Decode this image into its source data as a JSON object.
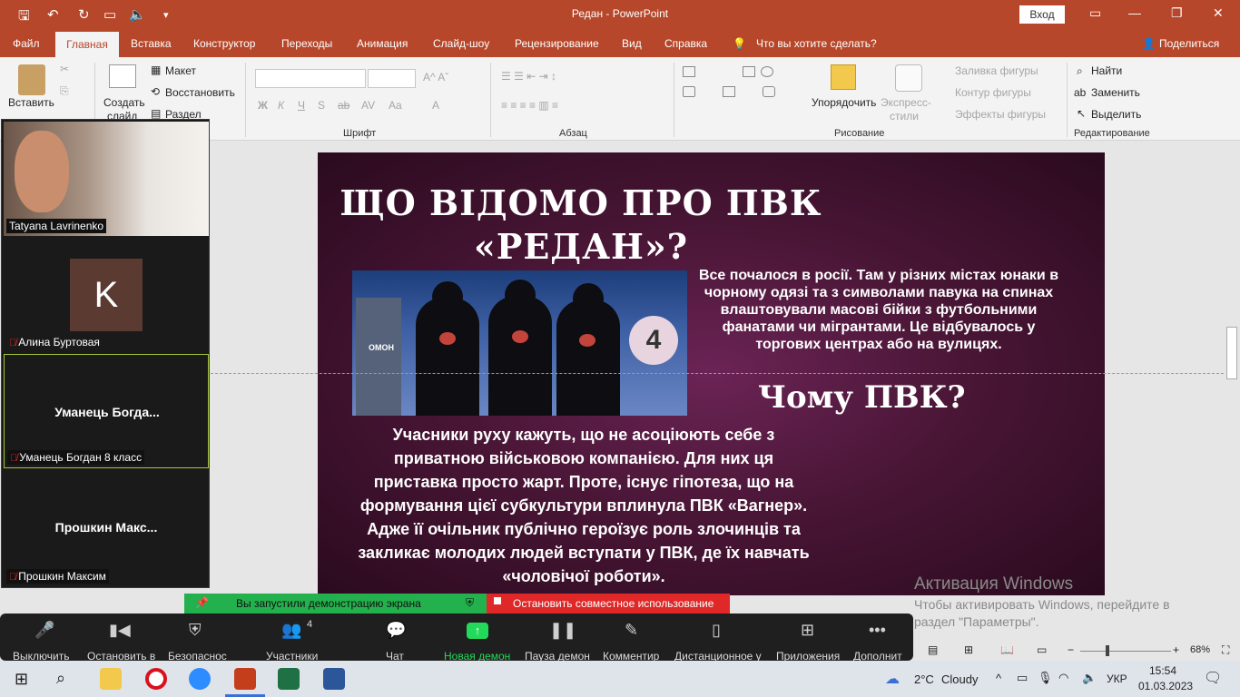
{
  "window": {
    "title": "Редан  -  PowerPoint",
    "signin_label": "Вход",
    "qat_icons": [
      "save-icon",
      "undo-icon",
      "redo-icon",
      "slideshow-icon",
      "volume-icon",
      "customize-icon"
    ]
  },
  "ribbon_tabs": [
    "Файл",
    "Главная",
    "Вставка",
    "Конструктор",
    "Переходы",
    "Анимация",
    "Слайд-шоу",
    "Рецензирование",
    "Вид",
    "Справка"
  ],
  "tell_me": "Что вы хотите сделать?",
  "share_label": "Поделиться",
  "ribbon": {
    "paste": "Вставить",
    "new_slide_1": "Создать",
    "new_slide_2": "слайд",
    "layout": "Макет",
    "reset": "Восстановить",
    "section": "Раздел",
    "font_group": "Шрифт",
    "paragraph_group": "Абзац",
    "drawing_group": "Рисование",
    "editing_group": "Редактирование",
    "arrange": "Упорядочить",
    "quick_styles_1": "Экспресс-",
    "quick_styles_2": "стили",
    "shape_fill": "Заливка фигуры",
    "shape_outline": "Контур фигуры",
    "shape_effects": "Эффекты фигуры",
    "find": "Найти",
    "replace": "Заменить",
    "select": "Выделить",
    "font_buttons": [
      "Ж",
      "К",
      "Ч",
      "S",
      "ab",
      "AV",
      "Aa",
      "A"
    ]
  },
  "slide": {
    "title": "ЩО ВІДОМО ПРО ПВК «РЕДАН»?",
    "paragraph1": "Все почалося в росії. Там у різних містах юнаки в чорному одязі та з символами павука на спинах влаштовували масові бійки з футбольними фанатами чи мігрантами. Це відбувалось у торгових центрах або на вулицях.",
    "heading2": "Чому ПВК?",
    "paragraph2": "Учасники руху кажуть, що не асоціюють себе з приватною військовою компанією. Для них ця приставка просто жарт. Проте, існує гіпотеза, що на формування цієї субкультури вплинула ПВК «Вагнер». Адже її очільник публічно героїзує роль злочинців та закликає молодих людей вступати у ПВК, де їх навчать «чоловічої роботи».",
    "image_label_omon": "ОМОН",
    "image_number": "4"
  },
  "participants": [
    {
      "name": "Tatyana Lavrinenko",
      "video": true,
      "muted": false
    },
    {
      "name": "Алина Буртовая",
      "avatar_letter": "K",
      "muted": true
    },
    {
      "name": "Уманець Богдан 8 класс",
      "display": "Уманець  Богда...",
      "muted": true,
      "active": true
    },
    {
      "name": "Прошкин Максим",
      "display": "Прошкин  Макс...",
      "muted": true
    }
  ],
  "share_banner": {
    "text": "Вы запустили демонстрацию экрана",
    "stop": "Остановить совместное использование"
  },
  "zoom_toolbar": {
    "mute": "Выключить",
    "video": "Остановить в",
    "security": "Безопаснос",
    "participants": "Участники",
    "participants_count": "4",
    "chat": "Чат",
    "new_share": "Новая демон",
    "pause_share": "Пауза демон",
    "annotate": "Комментир",
    "remote": "Дистанционное у",
    "apps": "Приложения",
    "more": "Дополнит"
  },
  "activation": {
    "title": "Активация Windows",
    "line1": "Чтобы активировать Windows, перейдите в",
    "line2": "раздел \"Параметры\"."
  },
  "statusbar": {
    "zoom": "68%"
  },
  "taskbar": {
    "weather_temp": "2°C",
    "weather_text": "Cloudy",
    "lang": "УКР",
    "time": "15:54",
    "date": "01.03.2023"
  },
  "colors": {
    "ppt_accent": "#b7472a",
    "share_green": "#23b14d",
    "stop_red": "#e02828",
    "zoom_green": "#23d959"
  }
}
